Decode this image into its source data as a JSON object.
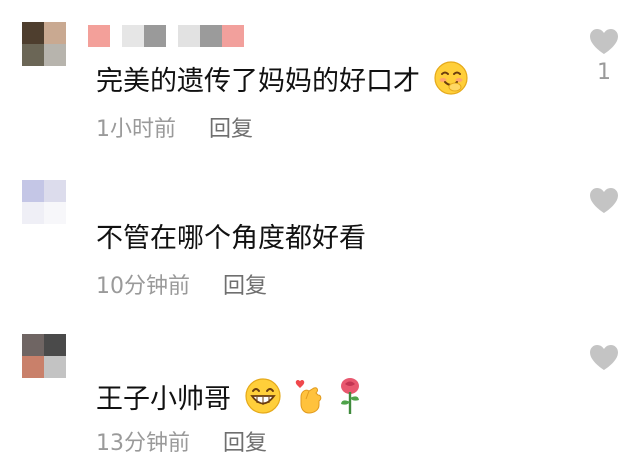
{
  "comments": [
    {
      "text": "完美的遗传了妈妈的好口才",
      "emojis": [
        "shy-smile-emoji"
      ],
      "time": "1小时前",
      "reply_label": "回复",
      "like_count": "1",
      "avatar_colors": [
        "#4e3e2e",
        "#c9a991",
        "#6b6656",
        "#b7b4ad"
      ],
      "name_colors": [
        "#f3a09a",
        "#d9d9d9",
        "#8f8f8f",
        "#e2e2e2",
        "#9b9b9b",
        "#f2a09c"
      ]
    },
    {
      "text": "不管在哪个角度都好看",
      "emojis": [],
      "time": "10分钟前",
      "reply_label": "回复",
      "like_count": "",
      "avatar_colors": [
        "#c4c6e6",
        "#dcdcec",
        "#efeff6",
        "#f7f7fa"
      ]
    },
    {
      "text": "王子小帅哥",
      "emojis": [
        "grin-emoji",
        "finger-heart-emoji",
        "rose-emoji"
      ],
      "time": "13分钟前",
      "reply_label": "回复",
      "like_count": "",
      "avatar_colors": [
        "#6f6563",
        "#4a4a4a",
        "#c9806a",
        "#c3c3c3"
      ]
    }
  ],
  "colors": {
    "text": "#111111",
    "meta": "#9a9a9a",
    "reply": "#6f6f6f",
    "heart": "#c4c4c4"
  }
}
